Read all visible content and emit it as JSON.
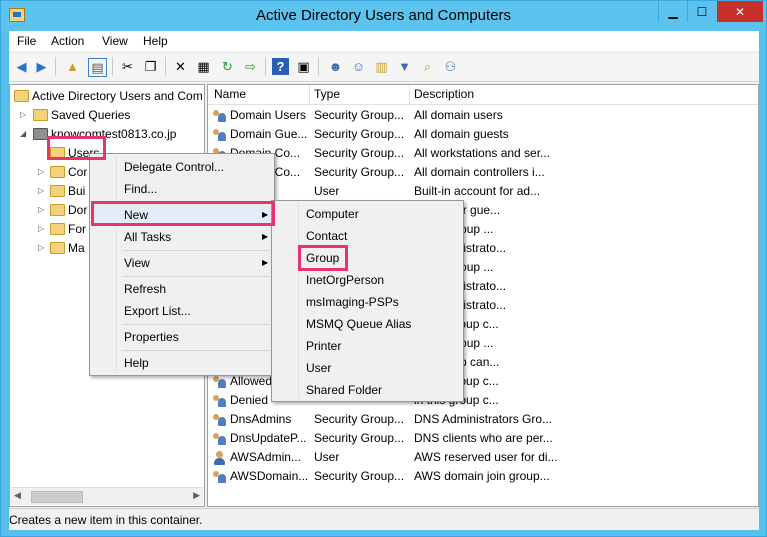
{
  "window": {
    "title": "Active Directory Users and Computers",
    "minimize_glyph": "▁",
    "maximize_glyph": "☐",
    "close_glyph": "✕"
  },
  "menubar": [
    "File",
    "Action",
    "View",
    "Help"
  ],
  "toolbar": {
    "icons": [
      "back-arrow-icon",
      "forward-arrow-icon",
      "up-folder-icon",
      "console-tree-icon",
      "cut-icon",
      "copy-icon",
      "delete-icon",
      "properties-icon",
      "refresh-icon",
      "export-icon",
      "help-icon",
      "details-pane-icon",
      "new-user-icon",
      "new-group-icon",
      "new-ou-icon",
      "filter-icon",
      "find-icon",
      "add-to-group-icon"
    ]
  },
  "tree": {
    "root": "Active Directory Users and Com",
    "saved_queries": "Saved Queries",
    "domain": "knowcomtest0813.co.jp",
    "users": "Users",
    "children": [
      "Cor",
      "Bui",
      "Dor",
      "For",
      "Ma"
    ]
  },
  "list": {
    "columns": [
      "Name",
      "Type",
      "Description"
    ],
    "rows": [
      {
        "name": "Domain Users",
        "type": "Security Group...",
        "desc": "All domain users",
        "icon": "group-icon"
      },
      {
        "name": "Domain Gue...",
        "type": "Security Group...",
        "desc": "All domain guests",
        "icon": "group-icon"
      },
      {
        "name": "Domain Co...",
        "type": "Security Group...",
        "desc": "All workstations and ser...",
        "icon": "group-icon"
      },
      {
        "name": "Domain Co...",
        "type": "Security Group...",
        "desc": "All domain controllers i...",
        "icon": "group-icon"
      },
      {
        "name": "rator",
        "type": "User",
        "desc": "Built-in account for ad...",
        "icon": "user-icon"
      },
      {
        "name": "",
        "type": "",
        "desc": "ccount for gue...",
        "icon": "user-icon"
      },
      {
        "name": "",
        "type": "",
        "desc": "of this group ...",
        "icon": "group-icon"
      },
      {
        "name": "",
        "type": "",
        "desc": "ed administrato...",
        "icon": "group-icon"
      },
      {
        "name": "",
        "type": "",
        "desc": "of this group ...",
        "icon": "group-icon"
      },
      {
        "name": "",
        "type": "",
        "desc": "ed administrato...",
        "icon": "group-icon"
      },
      {
        "name": "",
        "type": "",
        "desc": "ed administrato...",
        "icon": "group-icon"
      },
      {
        "name": "",
        "type": "",
        "desc": "in this group c...",
        "icon": "group-icon"
      },
      {
        "name": "",
        "type": "",
        "desc": "of this group ...",
        "icon": "group-icon"
      },
      {
        "name": "",
        "type": "",
        "desc": "this group can...",
        "icon": "group-icon"
      },
      {
        "name": "Allowed",
        "type": "",
        "desc": "in this group c...",
        "icon": "group-icon"
      },
      {
        "name": "Denied",
        "type": "",
        "desc": "in this group c...",
        "icon": "group-icon"
      },
      {
        "name": "DnsAdmins",
        "type": "Security Group...",
        "desc": "DNS Administrators Gro...",
        "icon": "group-icon"
      },
      {
        "name": "DnsUpdateP...",
        "type": "Security Group...",
        "desc": "DNS clients who are per...",
        "icon": "group-icon"
      },
      {
        "name": "AWSAdmin...",
        "type": "User",
        "desc": "AWS reserved user for di...",
        "icon": "user-icon"
      },
      {
        "name": "AWSDomain...",
        "type": "Security Group...",
        "desc": "AWS domain join group...",
        "icon": "group-icon"
      }
    ]
  },
  "context_menu": {
    "items": [
      "Delegate Control...",
      "Find...",
      "New",
      "All Tasks",
      "View",
      "Refresh",
      "Export List...",
      "Properties",
      "Help"
    ]
  },
  "new_submenu": {
    "items": [
      "Computer",
      "Contact",
      "Group",
      "InetOrgPerson",
      "msImaging-PSPs",
      "MSMQ Queue Alias",
      "Printer",
      "User",
      "Shared Folder"
    ]
  },
  "status": "Creates a new item in this container.",
  "colors": {
    "highlight": "#e8336e",
    "titlebar": "#5cc3ef",
    "close": "#c7302b"
  }
}
